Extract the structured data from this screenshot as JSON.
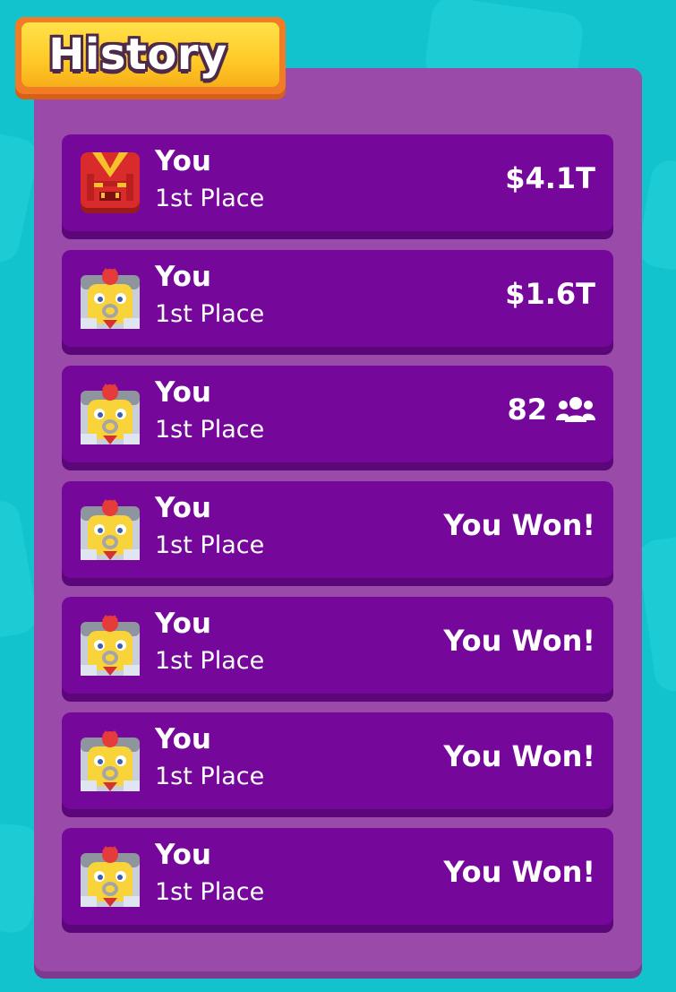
{
  "header": {
    "title": "History"
  },
  "colors": {
    "background": "#12c2cc",
    "panel": "#9a4aa8",
    "row": "#75089b",
    "title_badge": "#ffc928"
  },
  "history": {
    "rows": [
      {
        "player": "You",
        "place": "1st Place",
        "result": "$4.1T",
        "avatar": "red-knight-avatar-icon",
        "extra_icon": null
      },
      {
        "player": "You",
        "place": "1st Place",
        "result": "$1.6T",
        "avatar": "king-avatar-icon",
        "extra_icon": null
      },
      {
        "player": "You",
        "place": "1st Place",
        "result": "82",
        "avatar": "king-avatar-icon",
        "extra_icon": "players-icon"
      },
      {
        "player": "You",
        "place": "1st Place",
        "result": "You Won!",
        "avatar": "king-avatar-icon",
        "extra_icon": null
      },
      {
        "player": "You",
        "place": "1st Place",
        "result": "You Won!",
        "avatar": "king-avatar-icon",
        "extra_icon": null
      },
      {
        "player": "You",
        "place": "1st Place",
        "result": "You Won!",
        "avatar": "king-avatar-icon",
        "extra_icon": null
      },
      {
        "player": "You",
        "place": "1st Place",
        "result": "You Won!",
        "avatar": "king-avatar-icon",
        "extra_icon": null
      }
    ]
  }
}
